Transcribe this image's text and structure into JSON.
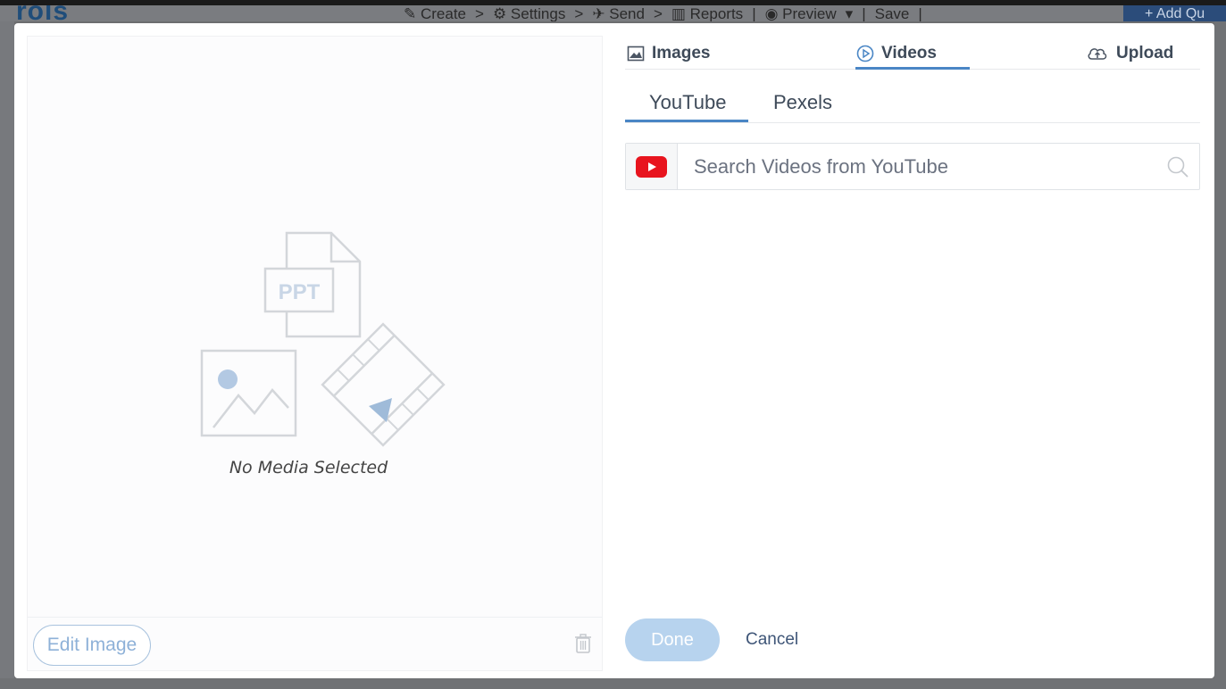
{
  "background": {
    "logo_text": "rols",
    "crumbs": [
      "✎ Create",
      ">",
      "⚙ Settings",
      ">",
      "✈ Send",
      ">",
      "▥ Reports",
      "|",
      "◉ Preview",
      "▾",
      "|",
      "Save",
      "|"
    ],
    "add_button": "+ Add Qu"
  },
  "preview": {
    "no_media_text": "No Media Selected",
    "illustration_badge": "PPT",
    "edit_button": "Edit Image"
  },
  "tabs_main": [
    {
      "label": "Images",
      "icon": "image-icon"
    },
    {
      "label": "Videos",
      "icon": "play-circle-icon",
      "active": true
    },
    {
      "label": "Upload",
      "icon": "cloud-upload-icon"
    }
  ],
  "tabs_sub": [
    {
      "label": "YouTube",
      "active": true
    },
    {
      "label": "Pexels"
    }
  ],
  "search": {
    "placeholder": "Search Videos from YouTube",
    "value": ""
  },
  "footer": {
    "done_label": "Done",
    "cancel_label": "Cancel"
  },
  "colors": {
    "accent": "#4a86c5",
    "done_disabled": "#b7d3ee",
    "youtube_red": "#e8141e"
  }
}
